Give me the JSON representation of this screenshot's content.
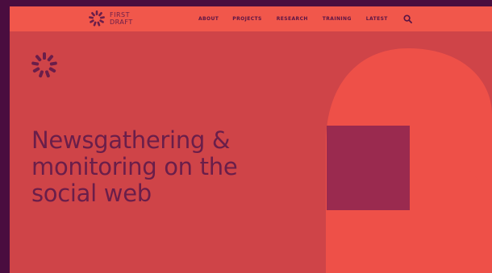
{
  "site": {
    "logo_line1": "FIRST",
    "logo_line2": "DRAFT"
  },
  "nav": {
    "items": [
      "ABOUT",
      "PROJECTS",
      "RESEARCH",
      "TRAINING",
      "LATEST"
    ],
    "search_icon": "search-icon"
  },
  "hero": {
    "headline_lines": [
      "Newsgathering &",
      "monitoring on the",
      "social web"
    ],
    "icon": "sunburst-logo-icon"
  },
  "colors": {
    "background_frame": "#4a0d3f",
    "page_background": "#cf4448",
    "header_background": "#f1574b",
    "headline_text": "#6a1e4a",
    "deco_shape": "#ee5048",
    "deco_square": "#9a2a4f"
  }
}
